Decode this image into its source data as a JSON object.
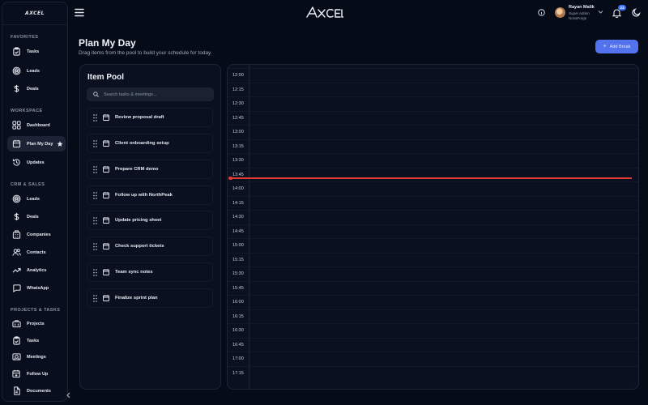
{
  "app": {
    "logo_text": "AXCEL",
    "brand": "AXCEL"
  },
  "sidebar": {
    "sections": [
      {
        "title": "FAVORITES"
      },
      {
        "title": "WORKSPACE"
      },
      {
        "title": "CRM & SALES"
      },
      {
        "title": "PROJECTS & TASKS"
      }
    ],
    "favorites": [
      {
        "label": "Tasks",
        "icon": "clipboard-check-icon"
      },
      {
        "label": "Leads",
        "icon": "target-icon"
      },
      {
        "label": "Deals",
        "icon": "dollar-icon"
      }
    ],
    "workspace": [
      {
        "label": "Dashboard",
        "icon": "grid-icon"
      },
      {
        "label": "Plan My Day",
        "icon": "calendar-icon",
        "active": true
      },
      {
        "label": "Updates",
        "icon": "history-icon"
      }
    ],
    "crm": [
      {
        "label": "Leads",
        "icon": "target-icon"
      },
      {
        "label": "Deals",
        "icon": "dollar-icon"
      },
      {
        "label": "Companies",
        "icon": "building-icon"
      },
      {
        "label": "Contacts",
        "icon": "users-icon"
      },
      {
        "label": "Analytics",
        "icon": "trending-up-icon"
      },
      {
        "label": "WhatsApp",
        "icon": "message-icon"
      }
    ],
    "projects": [
      {
        "label": "Projects",
        "icon": "briefcase-icon"
      },
      {
        "label": "Tasks",
        "icon": "clipboard-check-icon"
      },
      {
        "label": "Meetings",
        "icon": "camera-icon"
      },
      {
        "label": "Follow Up",
        "icon": "calendar-plus-icon"
      },
      {
        "label": "Documents",
        "icon": "file-icon"
      }
    ]
  },
  "user": {
    "name": "Rayan Malik",
    "role": "Super Admin",
    "org": "NovaForge",
    "notification_count": "23"
  },
  "page": {
    "title": "Plan My Day",
    "subtitle": "Drag items from the pool to build your schedule for today.",
    "add_break_label": "Add Break"
  },
  "pool": {
    "title": "Item Pool",
    "search_placeholder": "Search tasks & meetings...",
    "items": [
      "Review proposal draft",
      "Client onboarding setup",
      "Prepare CRM demo",
      "Follow up with NorthPeak",
      "Update pricing sheet",
      "Check support tickets",
      "Team sync notes",
      "Finalize sprint plan"
    ]
  },
  "schedule": {
    "times": [
      "12:00",
      "12:15",
      "12:30",
      "12:45",
      "13:00",
      "13:15",
      "13:30",
      "13:45",
      "14:00",
      "14:15",
      "14:30",
      "14:45",
      "15:00",
      "15:15",
      "15:30",
      "15:45",
      "16:00",
      "16:15",
      "16:30",
      "16:45",
      "17:00",
      "17:15"
    ],
    "current_time_color": "#e53935"
  },
  "colors": {
    "accent": "#5272ee",
    "background": "#060b18",
    "panel": "#0a1020"
  }
}
